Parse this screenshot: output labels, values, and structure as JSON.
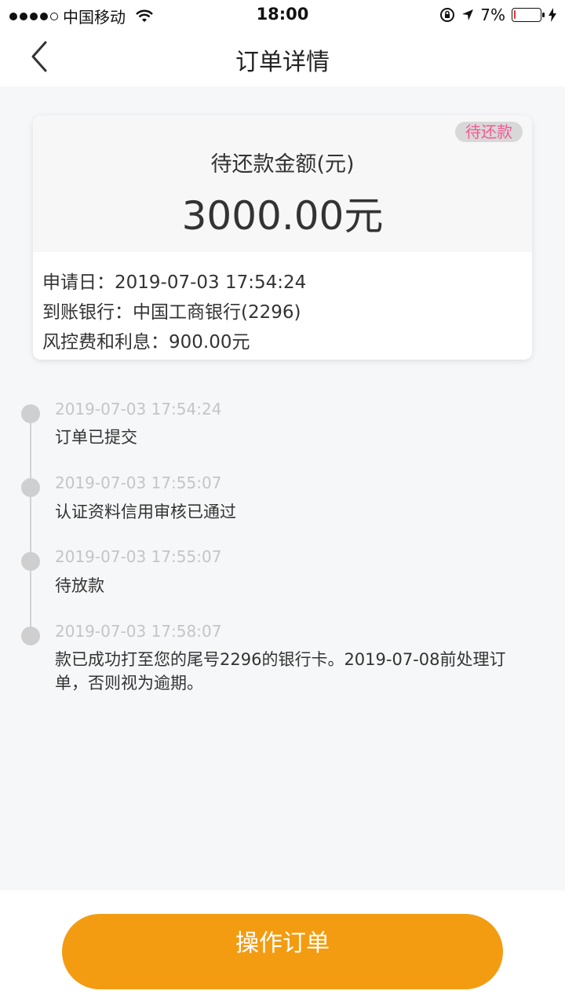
{
  "status_bar": {
    "carrier": "中国移动",
    "time": "18:00",
    "battery_percent_text": "7%",
    "battery_level": 0.07,
    "icons": [
      "signal-dots-icon",
      "wifi-icon",
      "orientation-lock-icon",
      "location-arrow-icon",
      "battery-icon",
      "charging-bolt-icon"
    ]
  },
  "nav": {
    "title": "订单详情",
    "back_icon": "chevron-left-icon"
  },
  "card": {
    "status_badge": "待还款",
    "amount_label": "待还款金额(元)",
    "amount_value": "3000.00元",
    "details": [
      "申请日：2019-07-03 17:54:24",
      "到账银行：中国工商银行(2296)",
      "风控费和利息：900.00元"
    ]
  },
  "timeline": [
    {
      "time": "2019-07-03 17:54:24",
      "text": "订单已提交"
    },
    {
      "time": "2019-07-03 17:55:07",
      "text": "认证资料信用审核已通过"
    },
    {
      "time": "2019-07-03 17:55:07",
      "text": "待放款"
    },
    {
      "time": "2019-07-03 17:58:07",
      "text": "款已成功打至您的尾号2296的银行卡。2019-07-08前处理订单，否则视为逾期。"
    }
  ],
  "footer": {
    "action_label": "操作订单"
  },
  "colors": {
    "accent": "#f39c12",
    "badge_text": "#f15a93",
    "battery_low": "#e33333"
  }
}
